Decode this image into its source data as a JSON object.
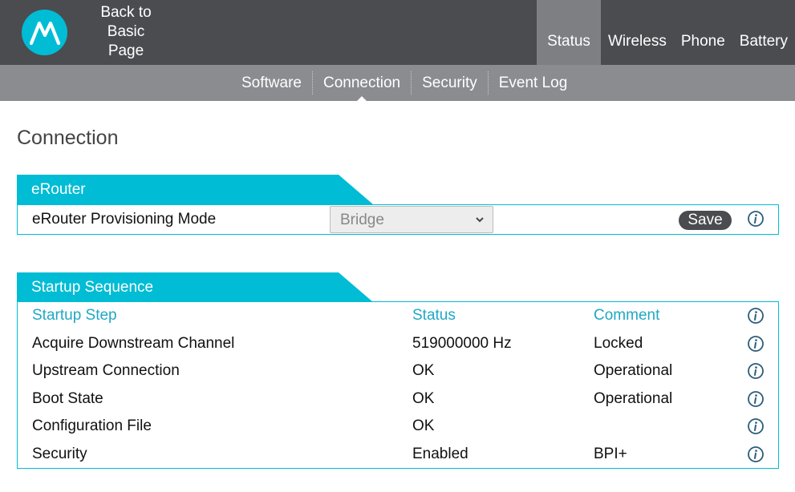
{
  "header": {
    "back_link": [
      "Back to",
      "Basic",
      "Page"
    ],
    "main_nav": [
      {
        "label": "Status",
        "active": true
      },
      {
        "label": "Wireless",
        "active": false
      },
      {
        "label": "Phone",
        "active": false
      },
      {
        "label": "Battery",
        "active": false
      }
    ],
    "sub_nav": [
      {
        "label": "Software",
        "active": false
      },
      {
        "label": "Connection",
        "active": true
      },
      {
        "label": "Security",
        "active": false
      },
      {
        "label": "Event Log",
        "active": false
      }
    ]
  },
  "page_title": "Connection",
  "erouter": {
    "title": "eRouter",
    "row_label": "eRouter Provisioning Mode",
    "select_value": "Bridge",
    "save_label": "Save"
  },
  "startup": {
    "title": "Startup Sequence",
    "headers": [
      "Startup Step",
      "Status",
      "Comment"
    ],
    "rows": [
      {
        "step": "Acquire Downstream Channel",
        "status": "519000000 Hz",
        "comment": "Locked"
      },
      {
        "step": "Upstream Connection",
        "status": "OK",
        "comment": "Operational"
      },
      {
        "step": "Boot State",
        "status": "OK",
        "comment": "Operational"
      },
      {
        "step": "Configuration File",
        "status": "OK",
        "comment": ""
      },
      {
        "step": "Security",
        "status": "Enabled",
        "comment": "BPI+"
      }
    ]
  },
  "colors": {
    "accent": "#00bcd4",
    "header_bg": "#4a4c50",
    "subnav_bg": "#8a8c90",
    "header_text": "#1fa8c6"
  },
  "icons": {
    "logo": "motorola-logo",
    "info": "info-icon",
    "dropdown": "chevron-down-icon"
  }
}
